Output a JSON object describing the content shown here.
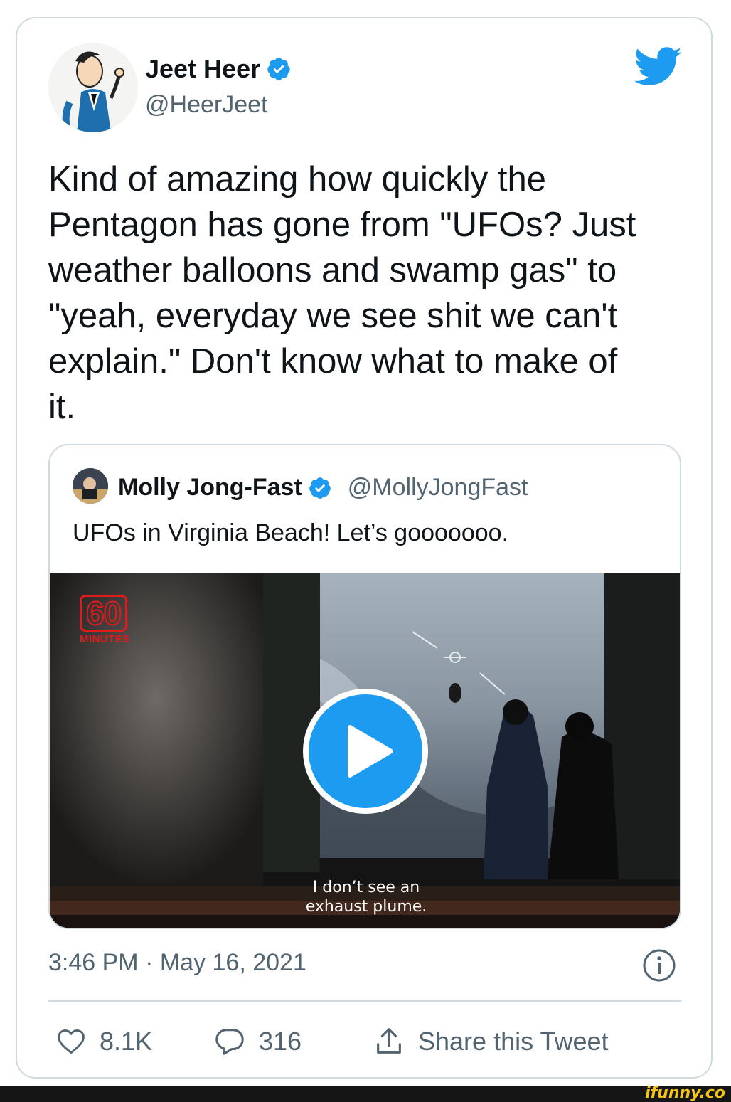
{
  "tweet": {
    "author_name": "Jeet Heer",
    "author_handle": "@HeerJeet",
    "text": "Kind of amazing how quickly the\nPentagon has gone from \"UFOs? Just\nweather balloons and swamp gas\" to\n\"yeah, everyday we see shit we can't\nexplain.\" Don't know what to make of\nit.",
    "timestamp": "3:46 PM · May 16, 2021"
  },
  "quoted_tweet": {
    "author_name": "Molly Jong-Fast",
    "author_handle": "@MollyJongFast",
    "text": "UFOs in Virginia Beach! Let’s gooooooo.",
    "video": {
      "logo_number": "60",
      "logo_text": "MINUTES",
      "subtitle": "I don’t see an\nexhaust plume."
    }
  },
  "actions": {
    "likes": "8.1K",
    "replies": "316",
    "share_label": "Share this Tweet"
  },
  "watermark": "ifunny.co",
  "colors": {
    "twitter_blue": "#1d9bf0",
    "secondary_text": "#536471",
    "border": "#cfd9de"
  },
  "icons": [
    "verified-badge-icon",
    "twitter-bird-icon",
    "play-icon",
    "info-icon",
    "heart-icon",
    "reply-icon",
    "share-icon"
  ]
}
